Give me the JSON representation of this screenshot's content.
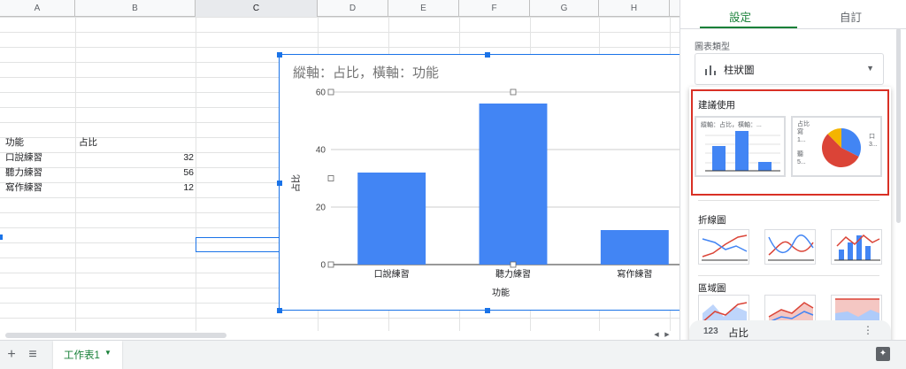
{
  "columns": [
    "A",
    "B",
    "C",
    "D",
    "E",
    "F",
    "G",
    "H"
  ],
  "table": {
    "header": [
      "功能",
      "占比"
    ],
    "rows": [
      [
        "口說練習",
        "32"
      ],
      [
        "聽力練習",
        "56"
      ],
      [
        "寫作練習",
        "12"
      ]
    ]
  },
  "chart_data": {
    "type": "bar",
    "title": "縱軸：占比，橫軸：功能",
    "xlabel": "功能",
    "ylabel": "占比",
    "categories": [
      "口說練習",
      "聽力練習",
      "寫作練習"
    ],
    "values": [
      32,
      56,
      12
    ],
    "ylim": [
      0,
      60
    ],
    "yticks": [
      0,
      20,
      40,
      60
    ],
    "grid": true,
    "color": "#4285f4"
  },
  "panel": {
    "tab_setup": "設定",
    "tab_customize": "自訂",
    "chart_type_label": "圖表類型",
    "chart_type_value": "柱狀圖",
    "recommended_label": "建議使用",
    "recommended_bar_title": "縱軸：占比，橫軸：...",
    "recommended_pie_title": "占比",
    "recommended_pie_left_top": "寫",
    "recommended_pie_left_mid": "1...",
    "recommended_pie_left_bot": "聽",
    "recommended_pie_left_bot2": "5...",
    "recommended_pie_right": "口",
    "recommended_pie_right2": "3...",
    "line_section_label": "折線圖",
    "area_section_label": "區域圖",
    "series_icon": "123",
    "series_name": "占比",
    "accent_color": "#188038",
    "highlight_color": "#d93025"
  },
  "bottom": {
    "add_sheet_icon": "+",
    "all_sheets_icon": "≡",
    "sheet_tab_label": "工作表1",
    "sheet_tab_caret": "▼",
    "explore_icon": "explore-icon"
  }
}
